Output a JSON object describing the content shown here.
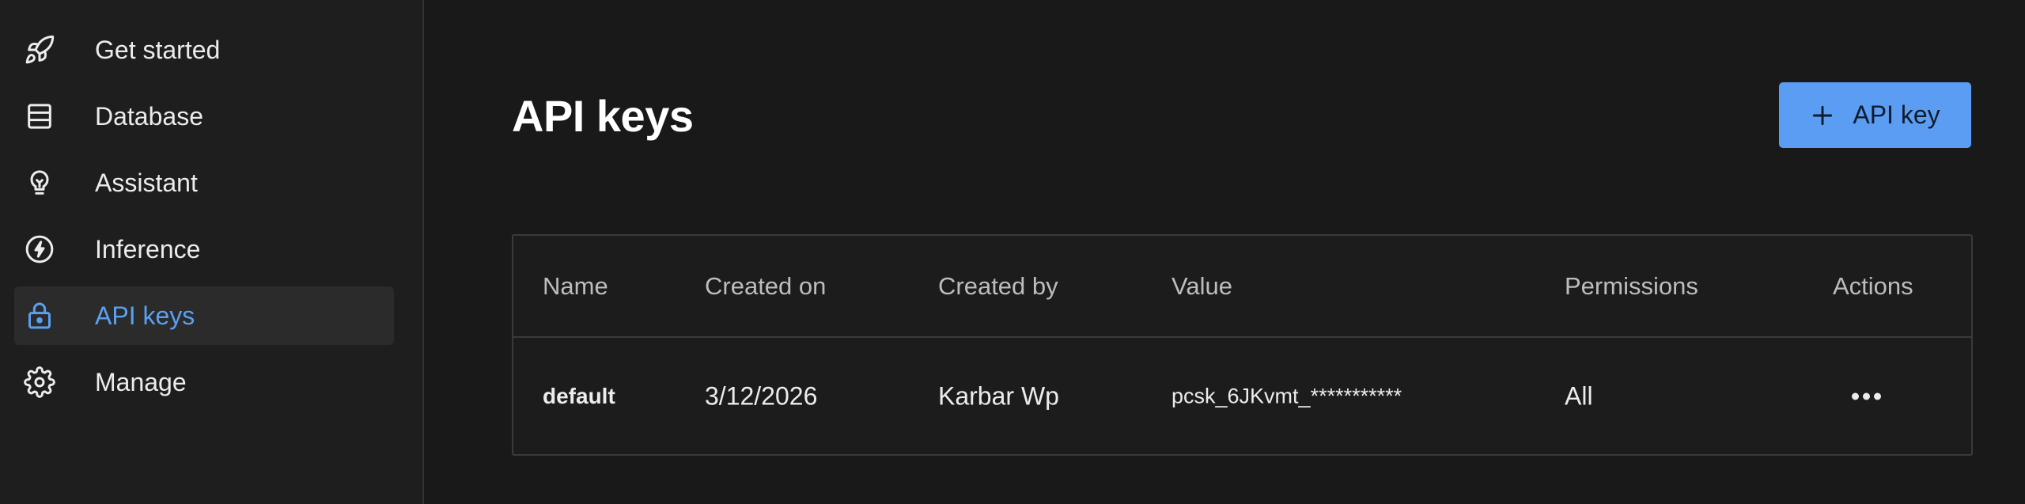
{
  "sidebar": {
    "items": [
      {
        "label": "Get started",
        "icon": "rocket-icon"
      },
      {
        "label": "Database",
        "icon": "database-icon"
      },
      {
        "label": "Assistant",
        "icon": "lightbulb-icon"
      },
      {
        "label": "Inference",
        "icon": "bolt-icon"
      },
      {
        "label": "API keys",
        "icon": "lock-icon",
        "active": true
      },
      {
        "label": "Manage",
        "icon": "gear-icon"
      }
    ]
  },
  "main": {
    "title": "API keys",
    "add_button_label": "API key",
    "table": {
      "headers": [
        "Name",
        "Created on",
        "Created by",
        "Value",
        "Permissions",
        "Actions"
      ],
      "rows": [
        {
          "name": "default",
          "created_on": "3/12/2026",
          "created_by": "Karbar Wp",
          "value": "pcsk_6JKvmt_***********",
          "permissions": "All"
        }
      ]
    }
  },
  "colors": {
    "background": "#191919",
    "sidebar": "#1e1e1e",
    "accent": "#5b9df2",
    "active_text": "#5aa0f2"
  }
}
